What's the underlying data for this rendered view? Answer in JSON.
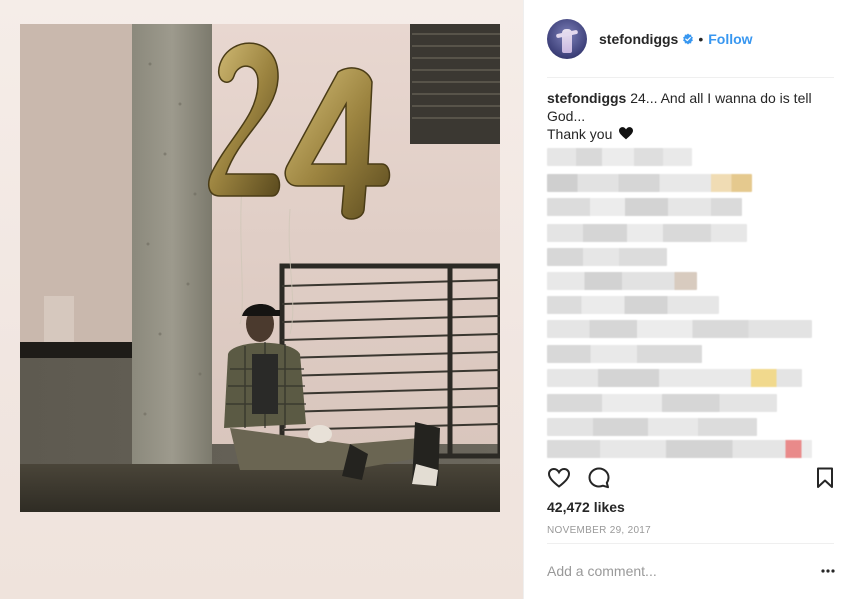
{
  "post": {
    "author": "stefondiggs",
    "follow_label": "Follow",
    "dot": "•",
    "caption_user": "stefondiggs",
    "caption_line1": "24... And all I wanna do is tell God...",
    "caption_line2": "Thank you",
    "likes": "42,472 likes",
    "date": "NOVEMBER 29, 2017",
    "comment_placeholder": "Add a comment..."
  },
  "photo": {
    "balloon_text": "24"
  },
  "icons": {
    "verified": "verified-badge-icon",
    "like": "heart-outline-icon",
    "comment": "speech-bubble-icon",
    "save": "bookmark-icon",
    "more": "ellipsis-icon",
    "caption_emoji": "black-heart-emoji"
  },
  "colors": {
    "link": "#3897f0",
    "verified": "#3897f0",
    "muted": "#999999",
    "text": "#262626"
  }
}
